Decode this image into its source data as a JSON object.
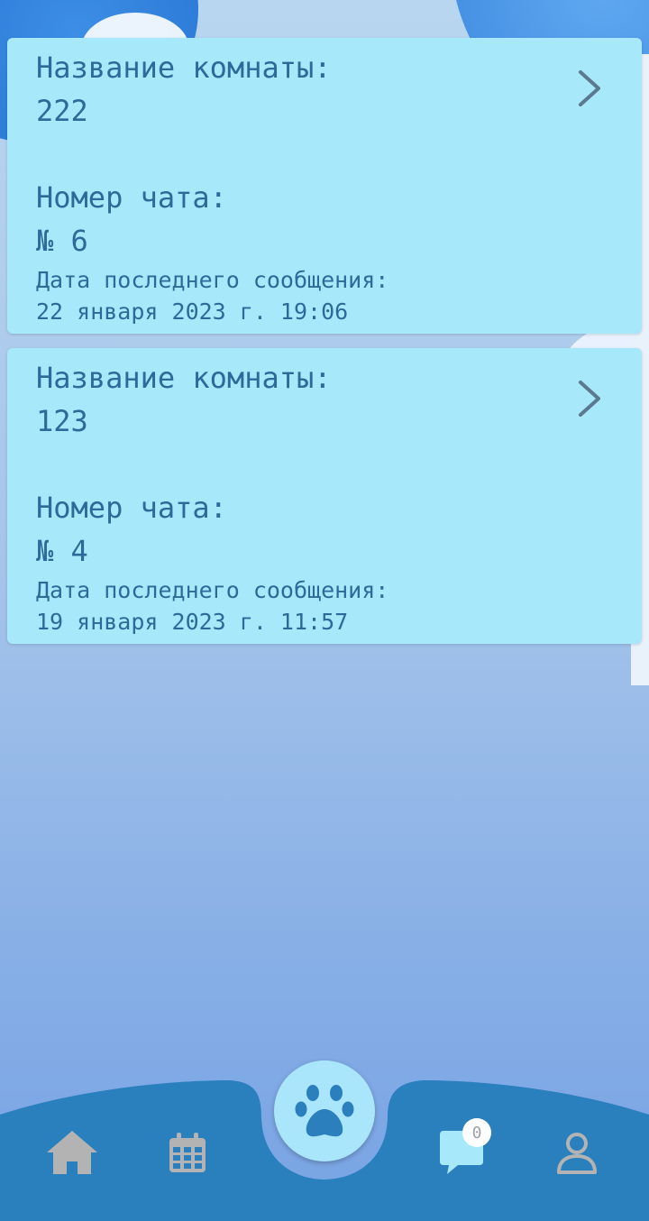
{
  "chats": [
    {
      "room_label": "Название комнаты:",
      "room_name": "222",
      "chat_label": "Номер чата:",
      "chat_number": "№ 6",
      "date_label": "Дата последнего сообщения:",
      "date_value": "22 января 2023 г. 19:06"
    },
    {
      "room_label": "Название комнаты:",
      "room_name": "123",
      "chat_label": "Номер чата:",
      "chat_number": "№ 4",
      "date_label": "Дата последнего сообщения:",
      "date_value": "19 января 2023 г. 11:57"
    }
  ],
  "bottom_nav": {
    "items": [
      {
        "icon": "home-icon"
      },
      {
        "icon": "calendar-icon"
      },
      {
        "icon": "paw-icon"
      },
      {
        "icon": "chat-icon",
        "badge": "0"
      },
      {
        "icon": "profile-icon"
      }
    ]
  },
  "colors": {
    "card_bg": "#a8e8fb",
    "text": "#2c6a99",
    "nav_bg": "#2a7fbd",
    "icon_gray": "#b3b3b3",
    "chat_icon": "#a8e8fb"
  }
}
